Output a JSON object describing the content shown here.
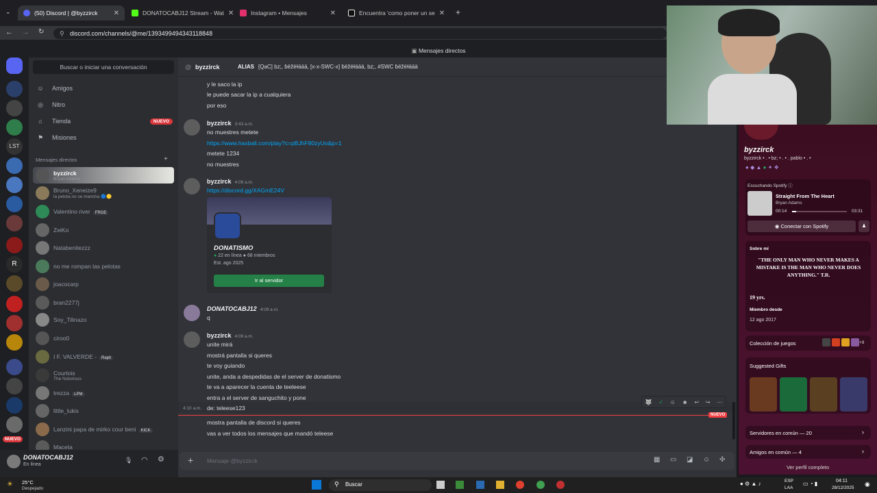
{
  "browser": {
    "tabs": [
      {
        "title": "(50) Discord | @byzzirck",
        "active": true,
        "color": "#5865f2"
      },
      {
        "title": "DONATOCABJ12 Stream - Wat",
        "active": false,
        "color": "#53fc18"
      },
      {
        "title": "Instagram • Mensajes",
        "active": false,
        "color": "#e1306c"
      },
      {
        "title": "Encuentra 'como poner un se",
        "active": false,
        "color": "#ffffff"
      }
    ],
    "url": "discord.com/channels/@me/1393499494343118848"
  },
  "discord": {
    "top_title": "Mensajes directos",
    "search_placeholder": "Buscar o iniciar una conversación",
    "nav": [
      {
        "label": "Amigos",
        "icon": "friends-icon"
      },
      {
        "label": "Nitro",
        "icon": "nitro-icon"
      },
      {
        "label": "Tienda",
        "icon": "shop-icon",
        "badge": "NUEVO"
      },
      {
        "label": "Misiones",
        "icon": "quests-icon"
      }
    ],
    "dm_header": "Mensajes directos",
    "dms": [
      {
        "name": "byzzirck",
        "sub": "Bryan Adams",
        "active": true,
        "color": "#555"
      },
      {
        "name": "Bruno_Xeneize9",
        "sub": "la pelota no se mancha 🔵🟡",
        "color": "#8a7a5a"
      },
      {
        "name": "Valentino river",
        "tag": "FRGE",
        "color": "#2e8b57"
      },
      {
        "name": "ZeiKo",
        "color": "#666"
      },
      {
        "name": "Natabenitezzz",
        "color": "#777"
      },
      {
        "name": "no me rompan las pelotas",
        "color": "#4a7a5a"
      },
      {
        "name": "joacocarp",
        "color": "#6a5a4a"
      },
      {
        "name": "bran2277j",
        "color": "#5a5a5a"
      },
      {
        "name": "Soy_Tilinazo",
        "color": "#888"
      },
      {
        "name": "ciroo0",
        "color": "#555"
      },
      {
        "name": "I F. VALVERDE -",
        "tag": "Rapit",
        "color": "#6a6a40"
      },
      {
        "name": "Courtois",
        "sub": "The Notorious",
        "color": "#3a3a3a"
      },
      {
        "name": "trezza",
        "tag": "LPM",
        "color": "#777"
      },
      {
        "name": "little_lukis",
        "color": "#666"
      },
      {
        "name": "Lanzini papa de mirko cour beni",
        "tag": "KICK",
        "color": "#8a6a4a"
      },
      {
        "name": "Maceta",
        "color": "#5a5a5a"
      }
    ],
    "user": {
      "name": "DONATOCABJ12",
      "status": "En línea"
    },
    "server_badge": "NUEVO",
    "chat_header": {
      "name": "byzzirck",
      "alias_label": "ALIAS",
      "alias": "[QaC] bz;, ɓëžëɫäää, [x-x-SWC-x] ɓëžëɫäää, bz;, #SWC ɓëžëɫäää"
    },
    "messages": [
      {
        "text": "y le saco la ip"
      },
      {
        "text": "le puede sacar la ip a cualquiera"
      },
      {
        "text": "por eso"
      },
      {
        "author": "byzzirck",
        "time": "3:43 a.m."
      },
      {
        "text": "no muestres metete"
      },
      {
        "text": "https://www.haxball.com/play?c=pBJhF80zyUo&p=1"
      },
      {
        "text": "metete 1234"
      },
      {
        "text": "no muestres"
      },
      {
        "author": "byzzirck",
        "time": "4:08 a.m."
      },
      {
        "text": "https://discord.gg/XAGmE24V"
      },
      {
        "author": "DONATOCABJ12",
        "time": "4:09 a.m."
      },
      {
        "text": "q"
      },
      {
        "author": "byzzirck",
        "time": "4:09 a.m."
      },
      {
        "text": "unite mirá"
      },
      {
        "text": "mostrá pantalla si queres"
      },
      {
        "text": "te voy guiando"
      },
      {
        "text": "unite, anda a despedidas de el server de donatismo"
      },
      {
        "text": "te va a aparecer la cuenta de teeleese"
      },
      {
        "text": "entra a el server de sanguchito y pone"
      },
      {
        "time": "4:10 a.m.",
        "text": "de: teleese123"
      },
      {
        "text": "mostra pantalla de discord si queres"
      },
      {
        "text": "vas a ver todos los mensajes que mandó teleese"
      }
    ],
    "new_divider": "NUEVO",
    "invite": {
      "name": "DONATISMO",
      "online": "22 en línea",
      "members": "68 miembros",
      "est": "Est. ago 2025",
      "button": "Ir al servidor"
    },
    "composer_placeholder": "Mensaje @byzzirck",
    "profile": {
      "display_name": "byzzirck",
      "handle": "byzzirck • . • bz; • . • . pablo • . •",
      "spotify_header": "Escuchando Spotify",
      "song": "Straight From The Heart",
      "artist": "Bryan Adams",
      "elapsed": "00:14",
      "duration": "03:31",
      "progress": 0.07,
      "spotify_button": "Conectar con Spotify",
      "about_label": "Sobre mí",
      "quote": "\"THE ONLY MAN WHO NEVER MAKES A MISTAKE IS THE MAN WHO NEVER DOES ANYTHING.\" T.R.",
      "age": "19 yrs.",
      "member_label": "Miembro desde",
      "member_date": "12 ago 2017",
      "games_label": "Colección de juegos",
      "games_more": "+9",
      "gifts_label": "Suggested Gifts",
      "mutual_servers": "Servidores en común — 20",
      "mutual_friends": "Amigos en común — 4",
      "full_profile": "Ver perfil completo"
    }
  },
  "taskbar": {
    "weather_temp": "25°C",
    "weather_text": "Despejado",
    "search": "Buscar",
    "lang1": "ESP",
    "lang2": "LAA",
    "time": "04:11",
    "date": "28/12/2025"
  }
}
